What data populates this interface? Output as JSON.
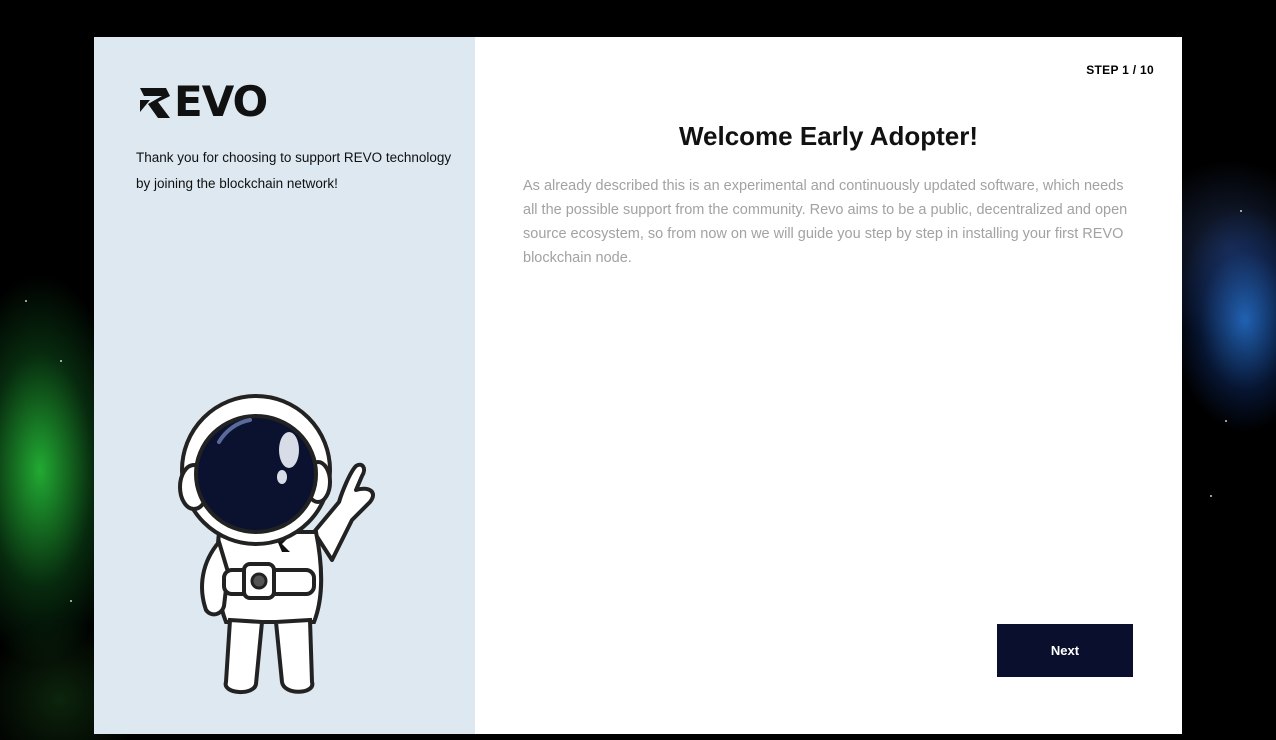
{
  "brand": {
    "logo_text": "EVO",
    "tagline": "Thank you for choosing to support REVO technology by joining the blockchain network!"
  },
  "wizard": {
    "step_label": "STEP 1 / 10",
    "title": "Welcome Early Adopter!",
    "description": "As already described this is an experimental and continuously updated software, which needs all the possible support from the community. Revo aims to be a public, decentralized and open source ecosystem, so from now on we will guide you step by step in installing your first REVO blockchain node.",
    "next_label": "Next"
  },
  "colors": {
    "panel_bg": "#dde8f0",
    "button_bg": "#0b0f2e",
    "text_muted": "#a2a2a2"
  }
}
